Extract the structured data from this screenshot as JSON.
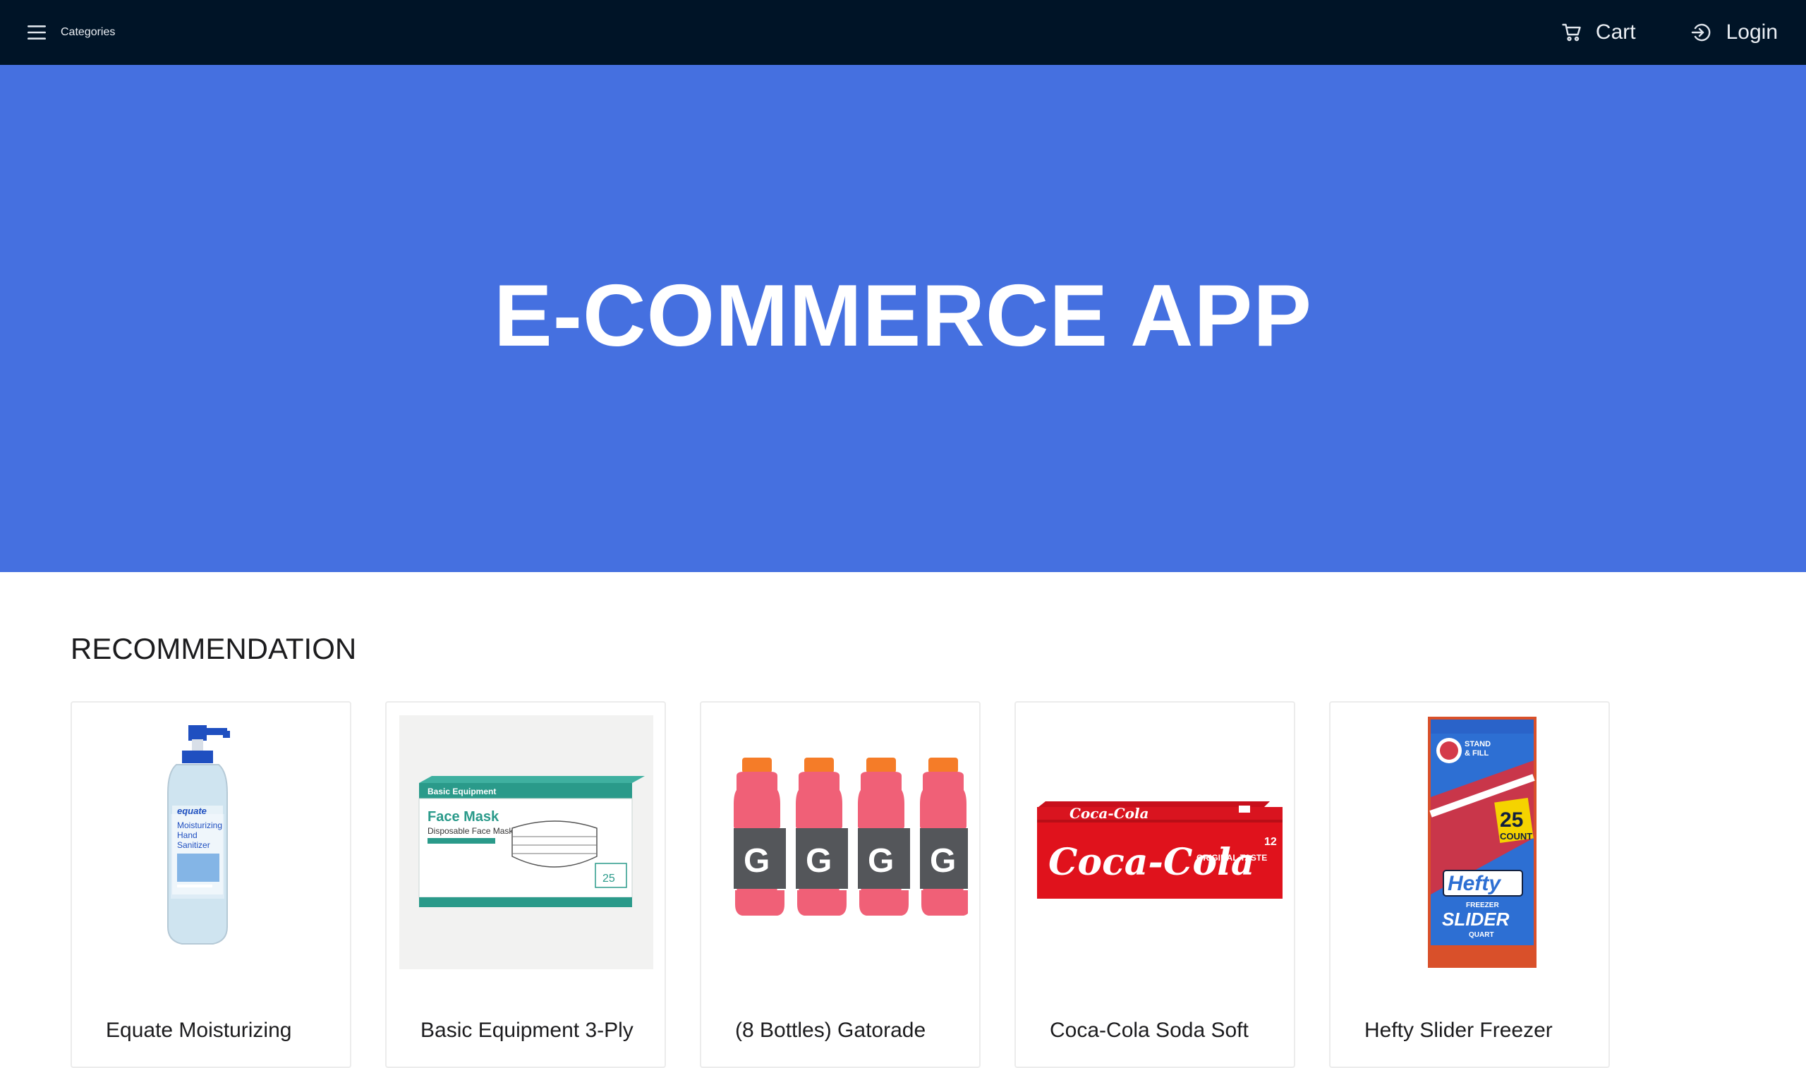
{
  "nav": {
    "categories_label": "Categories",
    "cart_label": "Cart",
    "login_label": "Login",
    "icons": {
      "menu": "hamburger-icon",
      "cart": "cart-icon",
      "login": "login-icon"
    }
  },
  "hero": {
    "title": "E-COMMERCE APP",
    "background": "#4570e0"
  },
  "section": {
    "title": "RECOMMENDATION"
  },
  "products": [
    {
      "title": "Equate Moisturizing"
    },
    {
      "title": "Basic Equipment 3-Ply"
    },
    {
      "title": "(8 Bottles) Gatorade"
    },
    {
      "title": "Coca-Cola Soda Soft"
    },
    {
      "title": "Hefty Slider Freezer"
    }
  ],
  "product_images": {
    "sanitizer": {
      "brand": "equate",
      "line1": "Moisturizing",
      "line2": "Hand",
      "line3": "Sanitizer"
    },
    "mask": {
      "brand": "Basic Equipment",
      "name": "Face Mask",
      "sub": "Disposable Face Mask",
      "count": "25"
    },
    "gatorade": {
      "logo": "G"
    },
    "coke": {
      "brand": "Coca-Cola",
      "tag": "ORIGINAL TASTE",
      "count": "12"
    },
    "hefty": {
      "count": "25",
      "count_word": "COUNT",
      "brand": "Hefty",
      "line1": "FREEZER",
      "line2": "SLIDER",
      "line3": "QUART"
    }
  },
  "colors": {
    "navbar": "#001427",
    "hero": "#4570e0"
  }
}
